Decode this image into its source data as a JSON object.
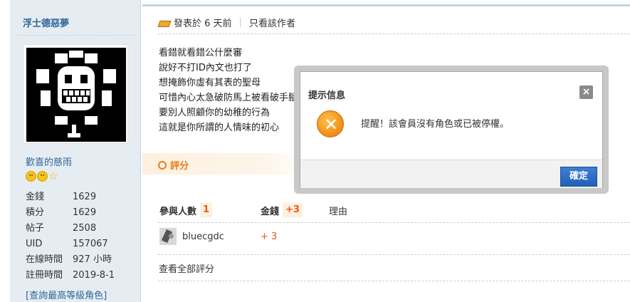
{
  "user": {
    "name": "浮士德惡夢",
    "group": "歡喜的慈雨",
    "stats": [
      {
        "label": "金錢",
        "value": "1629"
      },
      {
        "label": "積分",
        "value": "1629"
      },
      {
        "label": "帖子",
        "value": "2508"
      },
      {
        "label": "UID",
        "value": "157067"
      },
      {
        "label": "在線時間",
        "value": "927 小時"
      },
      {
        "label": "註冊時間",
        "value": "2019-8-1"
      }
    ],
    "query_link": "[查詢最高等級角色]"
  },
  "post": {
    "posted": "發表於 6 天前",
    "separator": "|",
    "only_author": "只看該作者",
    "lines": [
      "看錯就看錯公什麼審",
      "說好不打ID內文也打了",
      "想掩飾你虛有其表的聖母",
      "可惜內心太急破防馬上被看破手腳",
      "要別人照顧你的幼稚的行為",
      "這就是你所謂的人情味的初心"
    ]
  },
  "rating": {
    "button": "評分",
    "participants_label": "參與人數",
    "participants_count": "1",
    "money_label": "金錢",
    "money_total": "+3",
    "reason_label": "理由",
    "rows": [
      {
        "user": "bluecgdc",
        "score": "+ 3"
      }
    ],
    "view_all": "查看全部評分"
  },
  "dialog": {
    "title": "提示信息",
    "close": "×",
    "icon_glyph": "✕",
    "message": "提醒！該會員沒有角色或已被停權。",
    "ok": "確定"
  }
}
